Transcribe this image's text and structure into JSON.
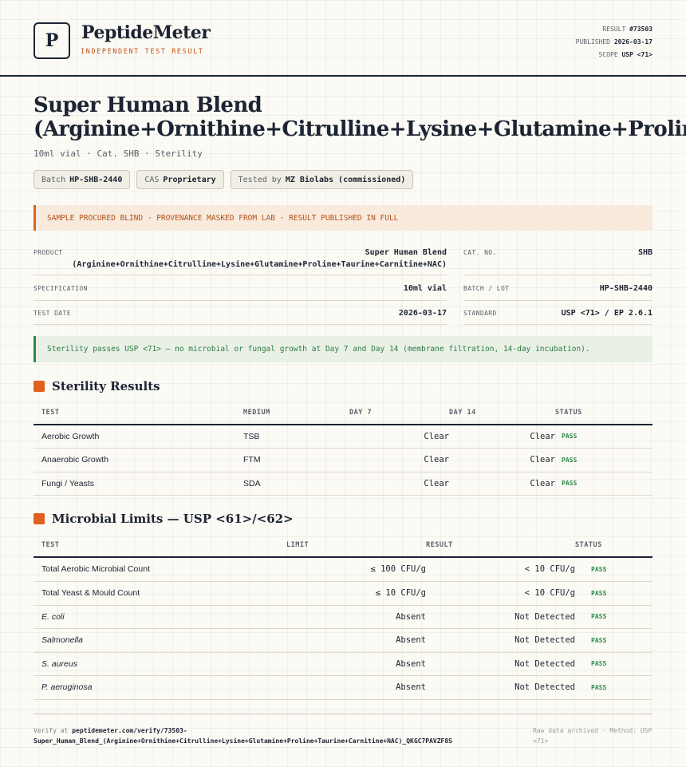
{
  "header": {
    "logo_letter": "P",
    "brand": "PeptideMeter",
    "tagline": "INDEPENDENT TEST RESULT",
    "result_label": "RESULT",
    "result_value": "#73503",
    "published_label": "PUBLISHED",
    "published_value": "2026-03-17",
    "scope_label": "SCOPE",
    "scope_value": "USP <71>"
  },
  "title": "Super Human Blend (Arginine+Ornithine+Citrulline+Lysine+Glutamine+Proline+Taurine+Carnitine+NAC)",
  "title_line1": "Super Human Blend",
  "title_line2": "(Arginine+Ornithine+Citrulline+Lysine+Glutamine+Proline+Taurine+Carnitine+NAC)",
  "subtitle": "10ml vial · Cat. SHB · Sterility",
  "chips": [
    {
      "label": "Batch",
      "value": "HP-SHB-2440"
    },
    {
      "label": "CAS",
      "value": "Proprietary"
    },
    {
      "label": "Tested by",
      "value": "MZ Biolabs (commissioned)"
    }
  ],
  "notice": "SAMPLE PROCURED BLIND · PROVENANCE MASKED FROM LAB · RESULT PUBLISHED IN FULL",
  "info": {
    "product_label": "PRODUCT",
    "product_value_1": "Super Human Blend",
    "product_value_2": "(Arginine+Ornithine+Citrulline+Lysine+Glutamine+Proline+Taurine+Carnitine+NAC)",
    "catno_label": "CAT. NO.",
    "catno_value": "SHB",
    "spec_label": "SPECIFICATION",
    "spec_value": "10ml vial",
    "batch_label": "BATCH / LOT",
    "batch_value": "HP-SHB-2440",
    "date_label": "TEST DATE",
    "date_value": "2026-03-17",
    "standard_label": "STANDARD",
    "standard_value": "USP <71> / EP 2.6.1"
  },
  "pass_banner": "Sterility passes USP <71> — no microbial or fungal growth at Day 7 and Day 14 (membrane filtration, 14-day incubation).",
  "sterility": {
    "title": "Sterility Results",
    "headers": [
      "TEST",
      "MEDIUM",
      "DAY 7",
      "DAY 14",
      "STATUS"
    ],
    "rows": [
      {
        "test": "Aerobic Growth",
        "medium": "TSB",
        "day7": "Clear",
        "day14": "Clear",
        "status": "PASS"
      },
      {
        "test": "Anaerobic Growth",
        "medium": "FTM",
        "day7": "Clear",
        "day14": "Clear",
        "status": "PASS"
      },
      {
        "test": "Fungi / Yeasts",
        "medium": "SDA",
        "day7": "Clear",
        "day14": "Clear",
        "status": "PASS"
      }
    ]
  },
  "microbial": {
    "title": "Microbial Limits — USP <61>/<62>",
    "headers": [
      "TEST",
      "LIMIT",
      "RESULT",
      "STATUS"
    ],
    "rows": [
      {
        "test": "Total Aerobic Microbial Count",
        "limit": "≤ 100 CFU/g",
        "result": "< 10 CFU/g",
        "status": "PASS"
      },
      {
        "test": "Total Yeast & Mould Count",
        "limit": "≤ 10 CFU/g",
        "result": "< 10 CFU/g",
        "status": "PASS"
      },
      {
        "test": "E. coli",
        "limit": "Absent",
        "result": "Not Detected",
        "status": "PASS"
      },
      {
        "test": "Salmonella",
        "limit": "Absent",
        "result": "Not Detected",
        "status": "PASS"
      },
      {
        "test": "S. aureus",
        "limit": "Absent",
        "result": "Not Detected",
        "status": "PASS"
      },
      {
        "test": "P. aeruginosa",
        "limit": "Absent",
        "result": "Not Detected",
        "status": "PASS"
      }
    ]
  },
  "footer": {
    "verify_prefix": "Verify at",
    "verify_url": "peptidemeter.com/verify/73503-Super_Human_Blend_(Arginine+Ornithine+Citrulline+Lysine+Glutamine+Proline+Taurine+Carnitine+NAC)_QKGC7PAVZF8S",
    "archived": "Raw data archived · Method: USP <71>"
  },
  "colors": {
    "accent": "#e0601d",
    "pass": "#2f8a4a",
    "ink": "#1c2333"
  }
}
